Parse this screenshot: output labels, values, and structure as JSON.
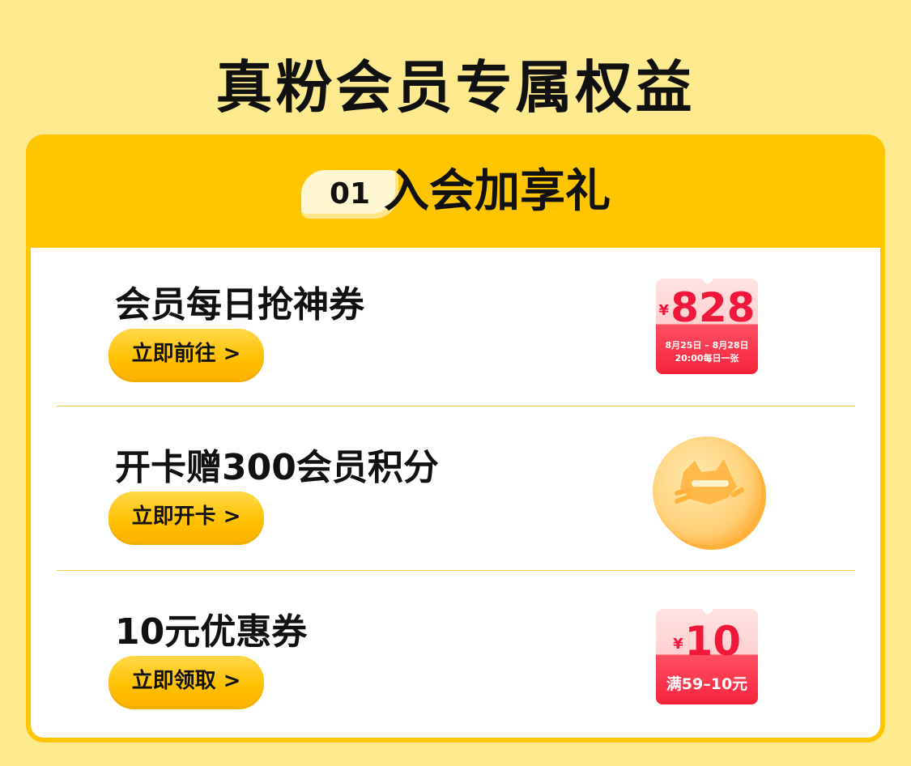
{
  "page": {
    "title": "真粉会员专属权益"
  },
  "section": {
    "number": "01",
    "title": "入会加享礼"
  },
  "rows": [
    {
      "title": "会员每日抢神券",
      "button": "立即前往 >",
      "coupon": {
        "currency": "¥",
        "value": "828",
        "line1": "8月25日 – 8月28日",
        "line2": "20:00每日一张"
      }
    },
    {
      "title": "开卡赠300会员积分",
      "button": "立即开卡 >",
      "icon": "coin-icon"
    },
    {
      "title": "10元优惠券",
      "button": "立即领取 >",
      "coupon": {
        "currency": "¥",
        "value": "10",
        "line1": "满59–10元"
      }
    }
  ],
  "colors": {
    "background": "#fdea8e",
    "panel": "#ffc600",
    "accent_red": "#f0183a"
  }
}
